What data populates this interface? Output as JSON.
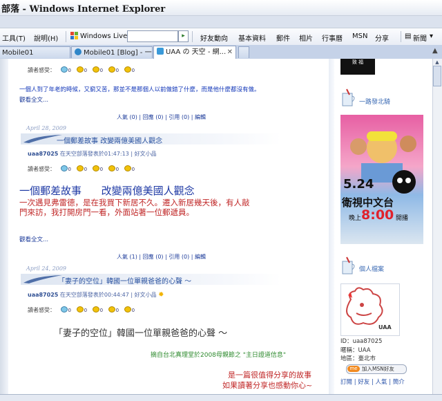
{
  "window": {
    "title": "部落 - Windows Internet Explorer"
  },
  "menu": {
    "tools": "工具(T)",
    "help": "說明(H)",
    "windows_live": "Windows Live",
    "search_placeholder": "",
    "items": [
      "好友動向",
      "基本資料",
      "郵件",
      "相片",
      "行事曆",
      "MSN",
      "分享"
    ],
    "news": "新聞"
  },
  "tabs": [
    {
      "label": "Mobile01"
    },
    {
      "label": "Mobile01 [Blog] - 一路..."
    },
    {
      "label": "UAA の 天空 - 網..."
    }
  ],
  "post0": {
    "reader_label": "讀者感受：",
    "counts": [
      "0",
      "0",
      "0",
      "0",
      "0"
    ],
    "excerpt": "一個人到了年老的時候，又窮又苦，那並不是那個人以前做錯了什麼，而是他什麼都沒有做。",
    "more": "觀看全文...",
    "stats": "人氣 (0) | 回應 (0) | 引用 (0) | 編輯"
  },
  "post1": {
    "date": "April 28, 2009",
    "title": "一個郵差故事  改變兩億美國人觀念",
    "meta_user": "uaa87025",
    "meta_rest": " 在天空部落發表於01:47:13 | 好文小品",
    "reader_label": "讀者感受：",
    "counts": [
      "0",
      "0",
      "0",
      "0",
      "0"
    ],
    "big_title": "一個郵差故事      改變兩億美國人觀念",
    "body_line1": "一次遇見弗雷德，是在我買下新居不久。遷入新居幾天後，有人敲",
    "body_line2": "門來訪，我打開房門一看，外面站著一位郵遞員。",
    "more": "觀看全文...",
    "stats": "人氣 (1) | 回應 (0) | 引用 (0) | 編輯"
  },
  "post2": {
    "date": "April 24, 2009",
    "title": "「妻子的空位」韓國一位單親爸爸的心聲 ～",
    "meta_user": "uaa87025",
    "meta_rest": " 在天空部落發表於00:44:47 | 好文小品",
    "reader_label": "讀者感受：",
    "counts": [
      "0",
      "0",
      "0",
      "0",
      "0"
    ],
    "big_title": "「妻子的空位」韓國一位單親爸爸的心聲 ～",
    "source": "摘自台北真理堂於2008母親節之 \"主日證道信息\"",
    "body_line1": "是一篇很值得分享的故事",
    "body_line2": "如果讀著分享也感動你心~"
  },
  "sidebar": {
    "ad_caption": "衛視中文台",
    "ad_date": "5.24",
    "ad_time_label": "晚上",
    "ad_time": "8:00",
    "ad_time_suffix": "開播",
    "ride_title": "一路發北騎",
    "profile_title": "個人檔案",
    "profile_name": "UAA",
    "id_label": "ID：",
    "id_value": "uaa87025",
    "nick_label": "暱稱：",
    "nick_value": "UAA",
    "area_label": "地區：",
    "area_value": "臺北市",
    "msn_button": "加入MSN好友",
    "links": "訂閱 | 好友 | 人氣 | 簡介",
    "top_caption": "致 福"
  },
  "colors": {
    "accent": "#3c6bb4",
    "link": "#1c3b9a",
    "title_red": "#c02727",
    "title_blue": "#1f3aa5",
    "green": "#2d8a2d"
  }
}
